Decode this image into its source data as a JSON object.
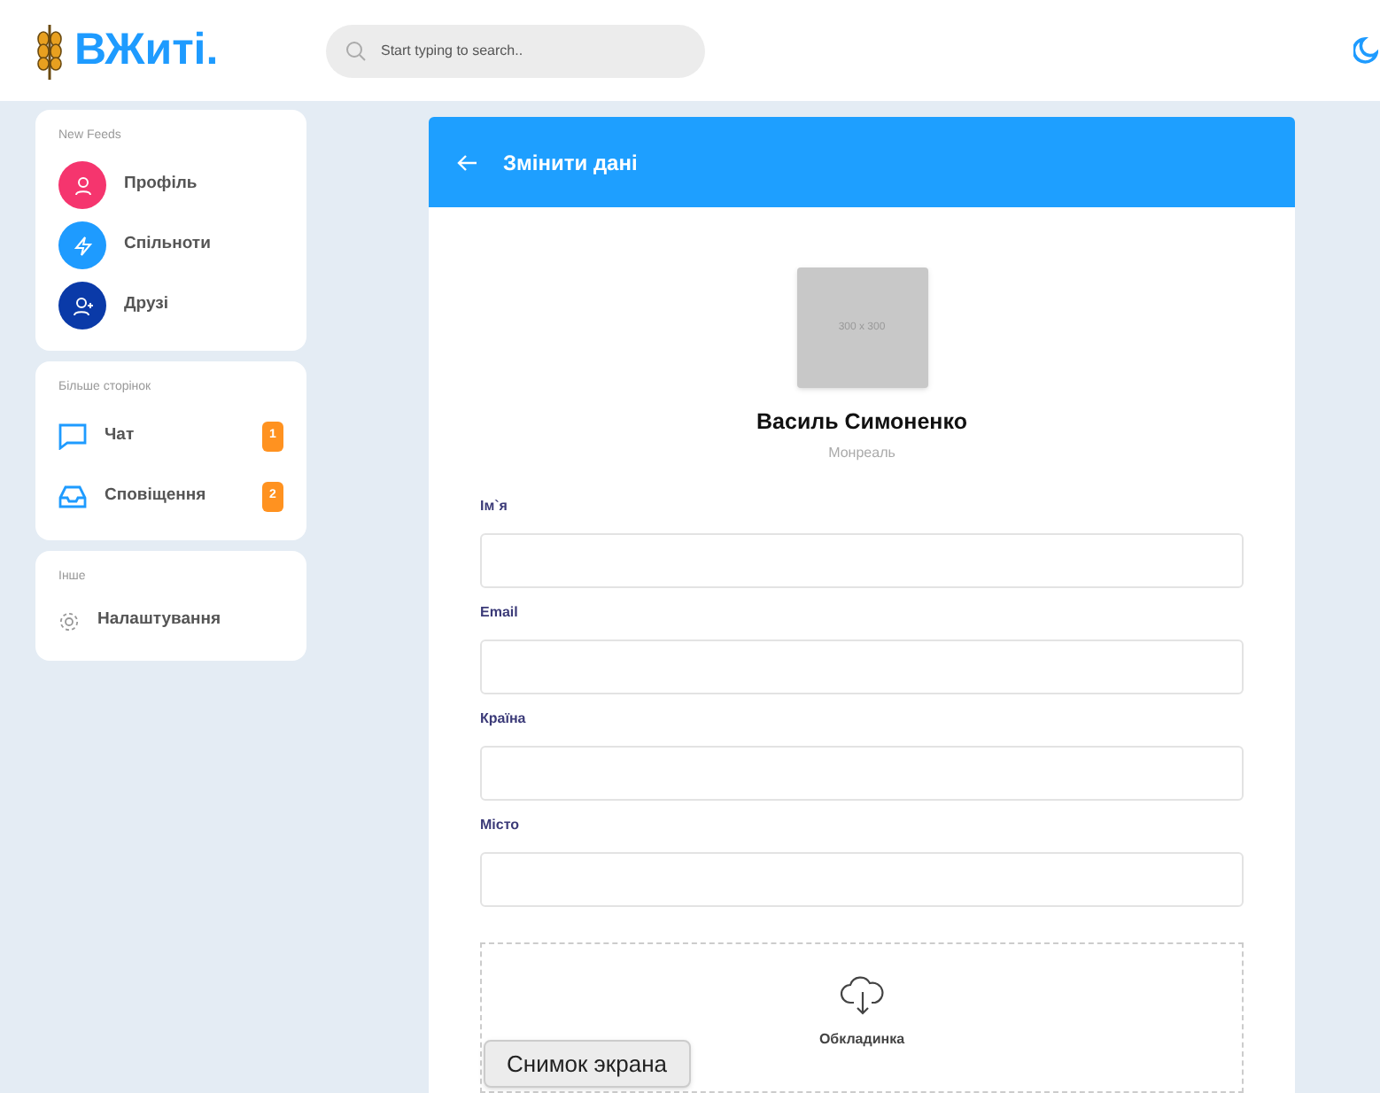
{
  "header": {
    "logo": "ВЖиті.",
    "search": {
      "placeholder": "Start typing to search.."
    }
  },
  "sidebar": {
    "sections": [
      {
        "title": "New Feeds",
        "items": [
          {
            "kind": "avatar",
            "label": "Профіль",
            "color": "#f5356e"
          },
          {
            "kind": "avatar",
            "label": "Спільноти",
            "color": "#1e9bff"
          },
          {
            "kind": "avatar",
            "label": "Друзі",
            "color": "#0a3aa8"
          }
        ]
      },
      {
        "title": "Більше сторінок",
        "items": [
          {
            "kind": "badge",
            "label": "Чат",
            "badge": "1"
          },
          {
            "kind": "badge",
            "label": "Сповіщення",
            "badge": "2"
          }
        ]
      },
      {
        "title": "Інше",
        "items": [
          {
            "kind": "plain",
            "label": "Налаштування"
          }
        ]
      }
    ]
  },
  "form": {
    "title": "Змінити дані",
    "photo": "300 x 300",
    "name": "Василь Симоненко",
    "city": "Монреаль",
    "fields": [
      {
        "label": "Ім`я"
      },
      {
        "label": "Email"
      },
      {
        "label": "Країна"
      },
      {
        "label": "Місто"
      }
    ],
    "upload": {
      "label": "Обкладинка"
    }
  },
  "tooltip": "Снимок экрана"
}
